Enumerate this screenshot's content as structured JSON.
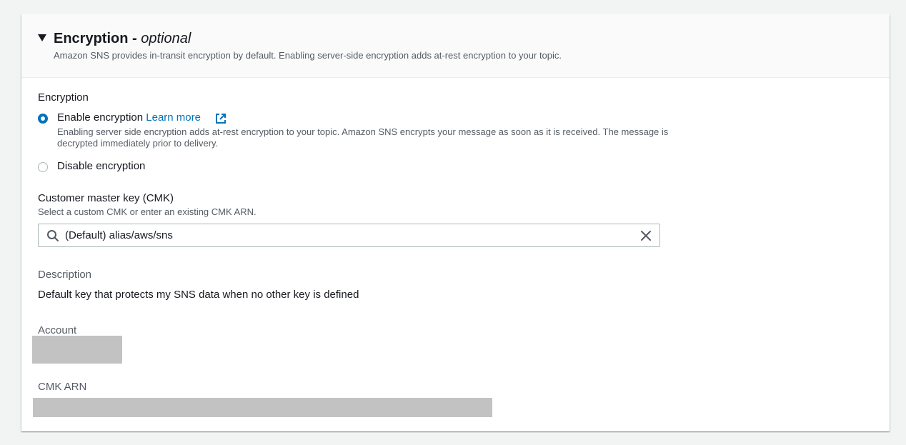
{
  "header": {
    "title": "Encryption - ",
    "title_optional": "optional",
    "description": "Amazon SNS provides in-transit encryption by default. Enabling server-side encryption adds at-rest encryption to your topic."
  },
  "encryption": {
    "label": "Encryption",
    "options": [
      {
        "label": "Enable encryption",
        "link": "Learn more",
        "description": "Enabling server side encryption adds at-rest encryption to your topic. Amazon SNS encrypts your message as soon as it is received. The message is decrypted immediately prior to delivery.",
        "selected": true
      },
      {
        "label": "Disable encryption",
        "selected": false
      }
    ]
  },
  "cmk": {
    "label": "Customer master key (CMK)",
    "hint": "Select a custom CMK or enter an existing CMK ARN.",
    "value": "(Default) alias/aws/sns"
  },
  "details": {
    "description_label": "Description",
    "description_value": "Default key that protects my SNS data when no other key is defined",
    "account_label": "Account",
    "arn_label": "CMK ARN"
  },
  "colors": {
    "accent": "#0073bb",
    "redacted": "#c2c2c2"
  },
  "icons": [
    "caret-down-icon",
    "external-link-icon",
    "search-icon",
    "clear-icon"
  ]
}
